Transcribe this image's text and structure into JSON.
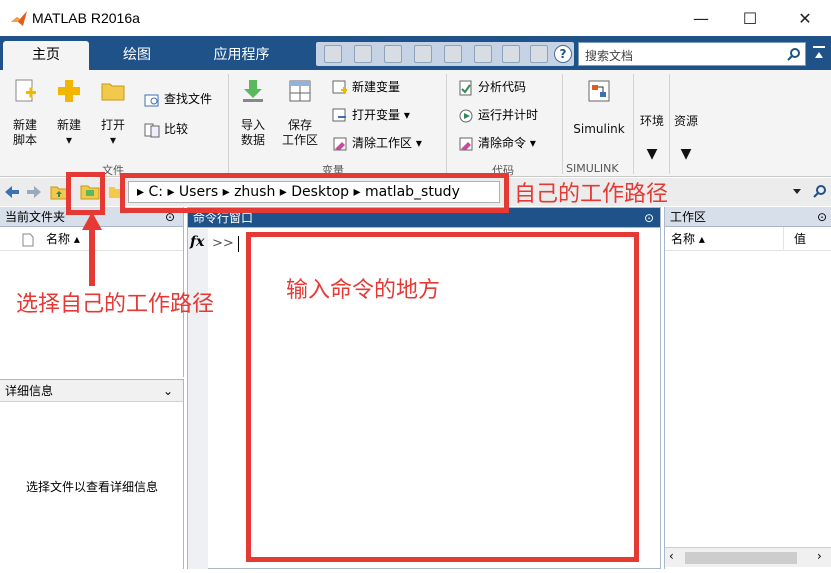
{
  "window": {
    "title": "MATLAB R2016a",
    "minimize": "—",
    "maximize": "☐",
    "close": "✕"
  },
  "tabs": [
    "主页",
    "绘图",
    "应用程序"
  ],
  "search": {
    "placeholder": "搜索文档"
  },
  "ribbon": {
    "file": {
      "new_script": "新建\n脚本",
      "new": "新建",
      "open": "打开",
      "find_files": "查找文件",
      "compare": "比较",
      "group_label": "文件"
    },
    "variable": {
      "import": "导入\n数据",
      "save": "保存\n工作区",
      "new_var": "新建变量",
      "open_var": "打开变量 ▾",
      "clear_ws": "清除工作区 ▾",
      "group_label": "变量"
    },
    "code": {
      "analyze": "分析代码",
      "run_time": "运行并计时",
      "clear_cmd": "清除命令 ▾",
      "group_label": "代码"
    },
    "simulink": {
      "label": "Simulink",
      "group_label": "SIMULINK"
    },
    "environment": "环境",
    "resources": "资源"
  },
  "path": [
    "C:",
    "Users",
    "zhush",
    "Desktop",
    "matlab_study"
  ],
  "current_folder": {
    "title": "当前文件夹",
    "column_name": "名称 ▴"
  },
  "details": {
    "title": "详细信息",
    "message": "选择文件以查看详细信息"
  },
  "command_window": {
    "title": "命令行窗口",
    "prompt": ">>"
  },
  "workspace": {
    "title": "工作区",
    "col_name": "名称 ▴",
    "col_value": "值"
  },
  "annotations": {
    "path_label": "自己的工作路径",
    "select_path": "选择自己的工作路径",
    "command_area": "输入命令的地方"
  }
}
